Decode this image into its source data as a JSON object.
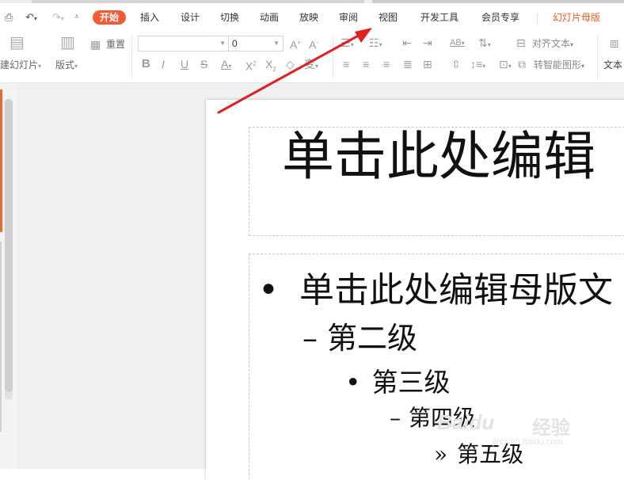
{
  "quick_access": {
    "icons": [
      "preview-icon",
      "undo-icon",
      "redo-icon",
      "customize-icon"
    ]
  },
  "tabs": [
    {
      "label": "开始",
      "active": true
    },
    {
      "label": "插入"
    },
    {
      "label": "设计"
    },
    {
      "label": "切换"
    },
    {
      "label": "动画"
    },
    {
      "label": "放映"
    },
    {
      "label": "审阅"
    },
    {
      "label": "视图"
    },
    {
      "label": "开发工具"
    },
    {
      "label": "会员专享"
    },
    {
      "label": "幻灯片母版",
      "accent": true
    }
  ],
  "ribbon": {
    "new_slide_label": "建幻灯片",
    "layout_label": "版式",
    "reset_label": "重置",
    "font_name_value": "",
    "font_size_value": "0",
    "align_text_label": "对齐文本",
    "smartart_label": "转智能图形",
    "textbox_label": "文本"
  },
  "slide": {
    "title": "单击此处编辑",
    "levels": [
      {
        "bullet": "•",
        "text": "单击此处编辑母版文"
      },
      {
        "bullet": "–",
        "text": "第二级"
      },
      {
        "bullet": "•",
        "text": "第三级"
      },
      {
        "bullet": "–",
        "text": "第四级"
      },
      {
        "bullet": "»",
        "text": "第五级"
      }
    ]
  },
  "watermark": {
    "brand": "Baidu",
    "suffix": "经验",
    "url": "jingyan.baidu.com"
  },
  "colors": {
    "accent": "#f25c34",
    "arrow": "#e02020"
  }
}
